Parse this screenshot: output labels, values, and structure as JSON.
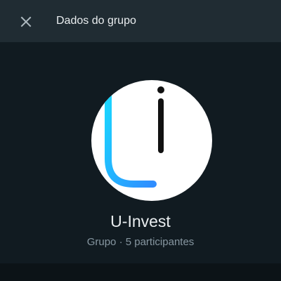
{
  "header": {
    "close_icon": "close-icon",
    "title": "Dados do grupo"
  },
  "group": {
    "avatar_icon": "u-invest-logo",
    "name": "U-Invest",
    "type": "Grupo",
    "separator": "·",
    "participants": "5 participantes"
  },
  "colors": {
    "background": "#111b21",
    "header": "#202c33",
    "primary_text": "#e9edef",
    "secondary_text": "#8696a0",
    "logo_cyan": "#1fd1f9",
    "logo_blue": "#3ea8ff"
  }
}
